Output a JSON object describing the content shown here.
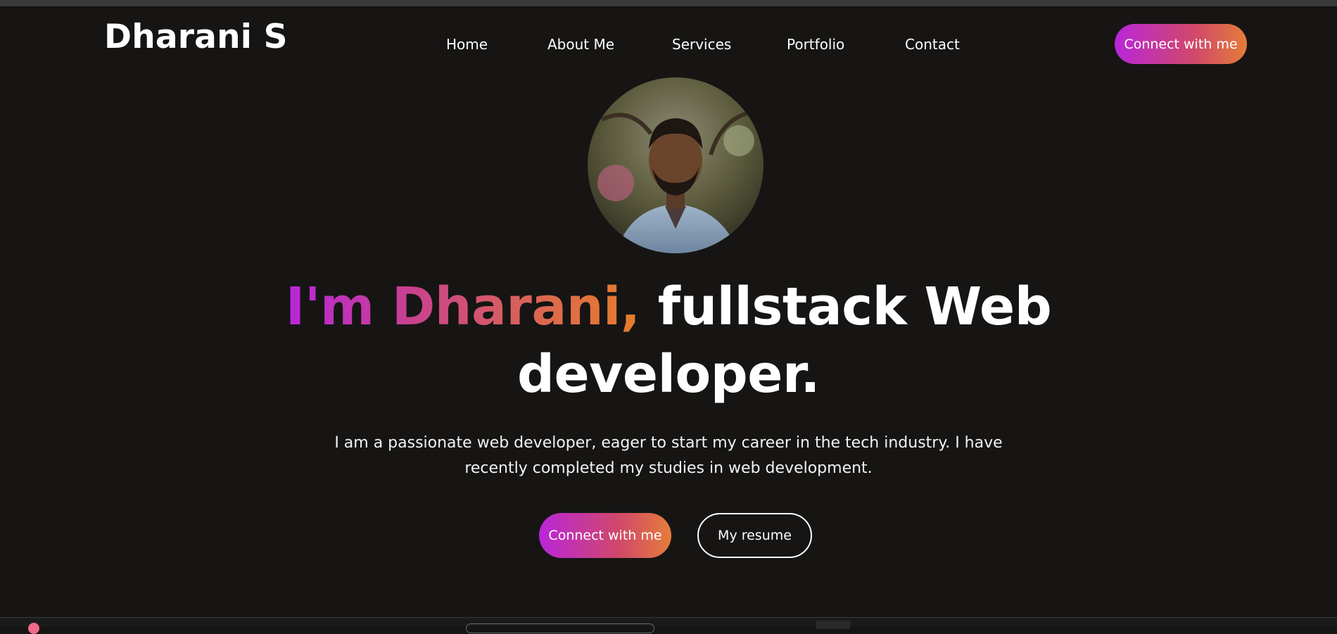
{
  "header": {
    "logo": "Dharani S",
    "nav": [
      {
        "label": "Home"
      },
      {
        "label": "About Me"
      },
      {
        "label": "Services"
      },
      {
        "label": "Portfolio"
      },
      {
        "label": "Contact"
      }
    ],
    "connect_label": "Connect with me"
  },
  "hero": {
    "headline_highlight": "I'm Dharani,",
    "headline_rest_line1": "fullstack Web",
    "headline_line2": "developer.",
    "intro_line1": "I am a passionate web developer, eager to start my career in the tech industry. I have",
    "intro_line2": "recently completed my studies in web development.",
    "primary_button": "Connect with me",
    "secondary_button": "My resume"
  },
  "colors": {
    "background": "#161514",
    "gradient_start": "#b926d9",
    "gradient_end": "#e57d3a",
    "text": "#ffffff"
  },
  "icons": {
    "avatar": "profile-photo"
  }
}
